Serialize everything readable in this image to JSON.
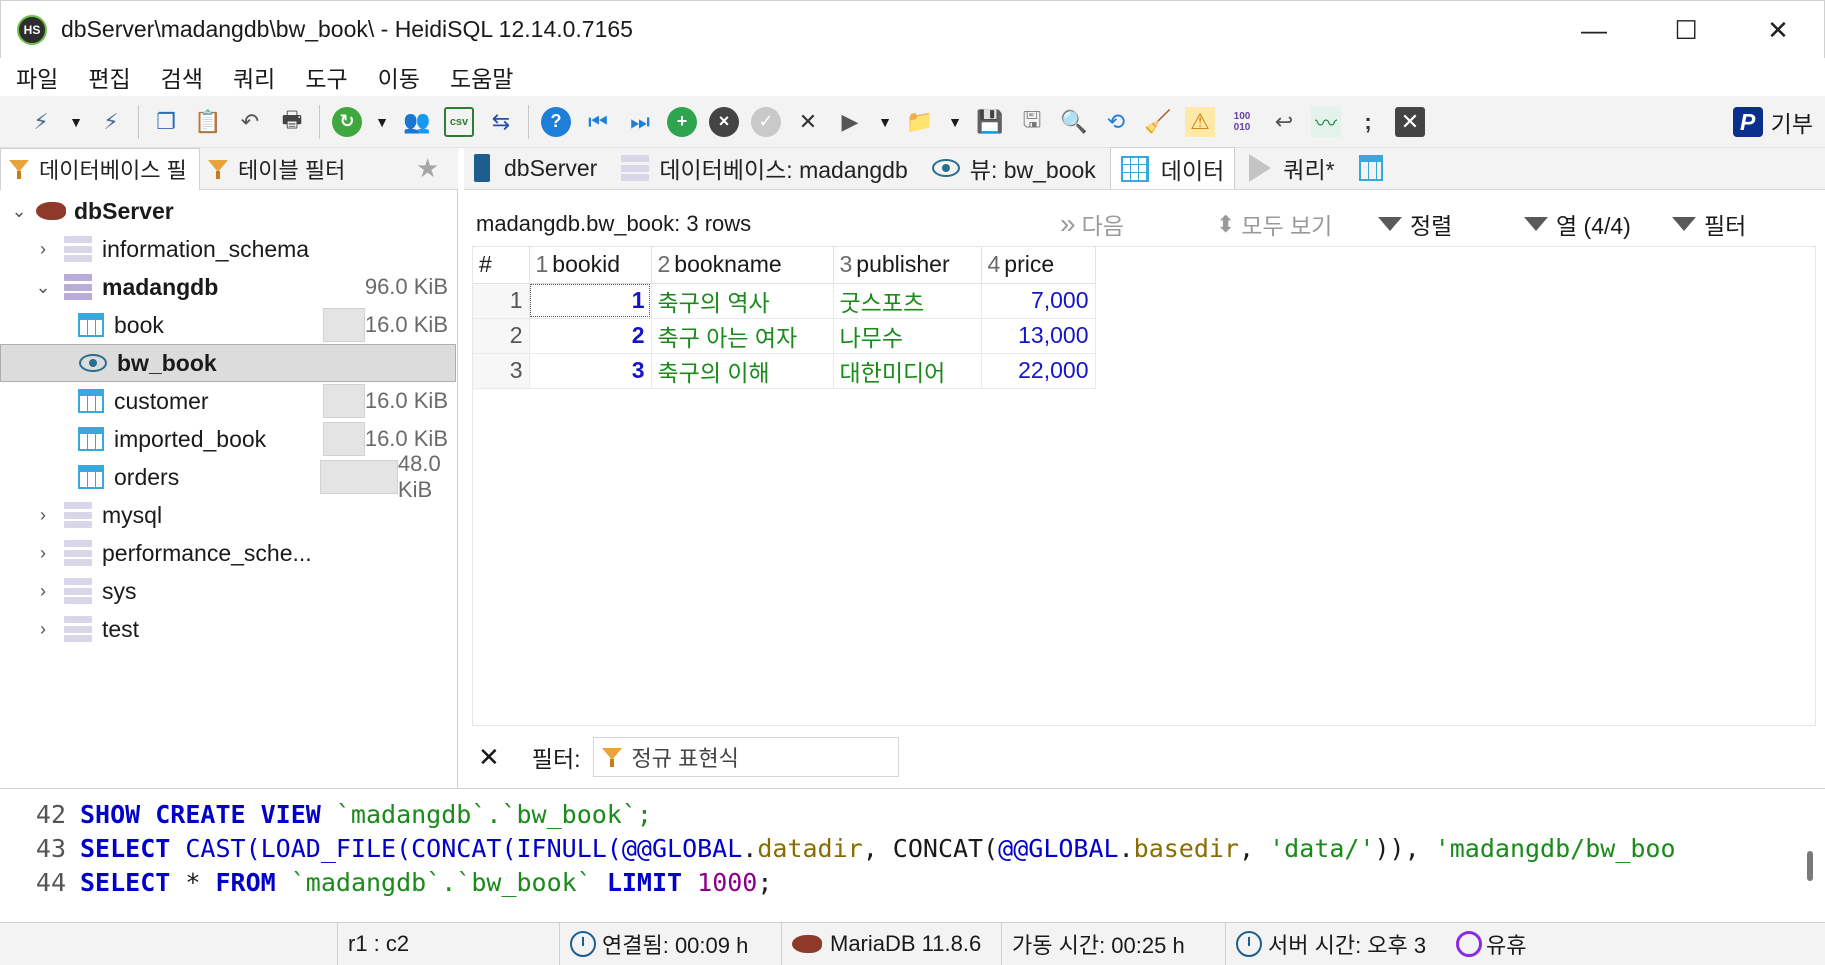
{
  "window": {
    "title": "dbServer\\madangdb\\bw_book\\ - HeidiSQL 12.14.0.7165",
    "app_icon_text": "HS",
    "minimize": "—",
    "maximize": "☐",
    "close": "✕"
  },
  "menu": [
    "파일",
    "편집",
    "검색",
    "쿼리",
    "도구",
    "이동",
    "도움말"
  ],
  "toolbar": {
    "donate_label": "기부",
    "paypal_glyph": "P"
  },
  "left_tabs": {
    "database_filter": "데이터베이스 필",
    "table_filter": "테이블 필터"
  },
  "tree": {
    "server": "dbServer",
    "items": [
      {
        "label": "information_schema"
      },
      {
        "label": "madangdb",
        "size": "96.0 KiB"
      },
      {
        "label": "book",
        "size": "16.0 KiB",
        "fill": 0.33
      },
      {
        "label": "bw_book"
      },
      {
        "label": "customer",
        "size": "16.0 KiB",
        "fill": 0.33
      },
      {
        "label": "imported_book",
        "size": "16.0 KiB",
        "fill": 0.33
      },
      {
        "label": "orders",
        "size": "48.0 KiB",
        "fill": 1.0
      },
      {
        "label": "mysql"
      },
      {
        "label": "performance_sche..."
      },
      {
        "label": "sys"
      },
      {
        "label": "test"
      }
    ]
  },
  "tabs": {
    "server": "dbServer",
    "database": "데이터베이스: madangdb",
    "view": "뷰: bw_book",
    "data": "데이터",
    "query": "쿼리*"
  },
  "data_panel": {
    "info": "madangdb.bw_book: 3 rows",
    "next": "다음",
    "show_all": "모두 보기",
    "sort": "정렬",
    "columns": "열 (4/4)",
    "filter": "필터"
  },
  "grid": {
    "header_hash": "#",
    "columns": [
      {
        "num": "1",
        "name": "bookid"
      },
      {
        "num": "2",
        "name": "bookname"
      },
      {
        "num": "3",
        "name": "publisher"
      },
      {
        "num": "4",
        "name": "price"
      }
    ],
    "rows": [
      {
        "n": "1",
        "bookid": "1",
        "bookname": "축구의 역사",
        "publisher": "굿스포츠",
        "price": "7,000"
      },
      {
        "n": "2",
        "bookid": "2",
        "bookname": "축구 아는 여자",
        "publisher": "나무수",
        "price": "13,000"
      },
      {
        "n": "3",
        "bookid": "3",
        "bookname": "축구의 이해",
        "publisher": "대한미디어",
        "price": "22,000"
      }
    ]
  },
  "filter_bar": {
    "close": "✕",
    "label": "필터:",
    "placeholder": "정규 표현식"
  },
  "sql_log": {
    "line_numbers": [
      "42",
      "43",
      "44"
    ],
    "line42": {
      "kw1": "SHOW CREATE VIEW",
      "rest": " `madangdb`.`bw_book`;"
    },
    "line43": {
      "kw1": "SELECT",
      "fn1": " CAST(LOAD_FILE(CONCAT(IFNULL(",
      "gv1": "@@GLOBAL",
      "p1": ".",
      "v1": "datadir",
      "p2": ", CONCAT(",
      "gv2": "@@GLOBAL",
      "p3": ".",
      "v2": "basedir",
      "p4": ", ",
      "s1": "'data/'",
      "p5": ")), ",
      "s2": "'madangdb/bw_boo"
    },
    "line44": {
      "kw1": "SELECT",
      "p1": " * ",
      "kw2": "FROM",
      "str": " `madangdb`.`bw_book`",
      "p2": " ",
      "kw3": "LIMIT",
      "p3": " ",
      "num": "1000",
      "p4": ";"
    }
  },
  "status": {
    "cursor": "r1 : c2",
    "connected": "연결됨: 00:09 h",
    "server_version": "MariaDB 11.8.6",
    "uptime": "가동 시간: 00:25 h",
    "server_time": "서버 시간: 오후 3",
    "idle": "유휴"
  }
}
